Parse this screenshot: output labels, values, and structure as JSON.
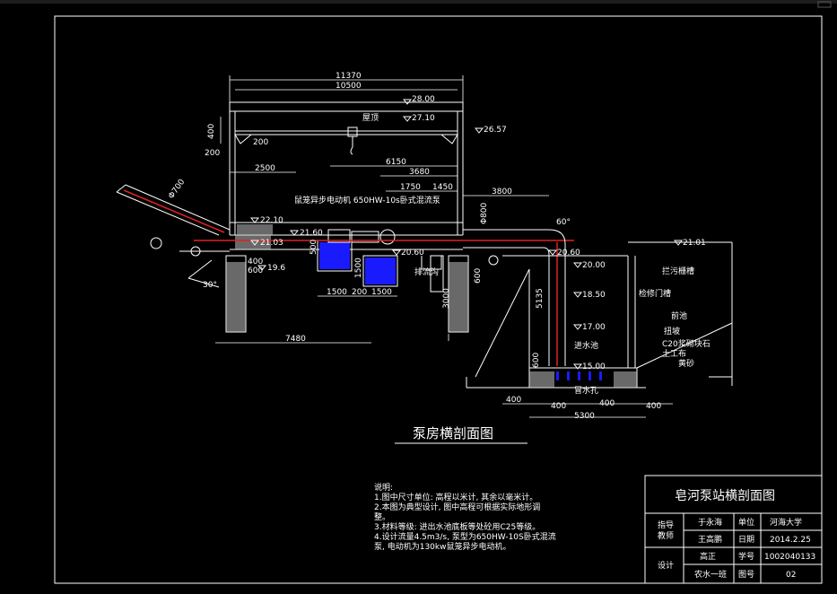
{
  "drawing": {
    "title": "泵房横剖面图",
    "dimensions": {
      "d11370": "11370",
      "d10500": "10500",
      "d400": "400",
      "d200a": "200",
      "d200b": "200",
      "d2500": "2500",
      "d6150": "6150",
      "d3680": "3680",
      "d1750": "1750",
      "d1450": "1450",
      "d3800": "3800",
      "phi800": "Φ800",
      "phi700": "Φ700",
      "d400b": "400",
      "d600": "600",
      "d500": "500",
      "d1500a": "1500",
      "d200c": "200",
      "d1500b": "1500",
      "d1500v": "1500",
      "d3000": "3000",
      "d600b": "600",
      "d5135": "5135",
      "d7480": "7480",
      "d400c": "400",
      "d400d": "400",
      "d400e": "400",
      "d400f": "400",
      "d5300": "5300",
      "ang30": "30°",
      "ang60": "60°",
      "d600c": "600"
    },
    "elevations": {
      "e2800": "28.00",
      "e2710": "27.10",
      "e2657": "26.57",
      "e2210": "22.10",
      "e2160": "21.60",
      "e2103": "21.03",
      "e196": "19.6",
      "e2060": "20.60",
      "e2060b": "20.60",
      "e2000": "20.00",
      "e2101": "21.01",
      "e1850": "18.50",
      "e1700": "17.00",
      "e1500": "15.00"
    },
    "labels": {
      "roof": "屋顶",
      "motor_pump": "鼠笼异步电动机  650HW-10s卧式混流泵",
      "drain_ditch": "排流沟",
      "trash_rack": "拦污栅槽",
      "gate_slot": "检修门槽",
      "forebay": "前池",
      "slope": "扭坡",
      "concrete": "C20浆砌块石",
      "geotextile": "土工布",
      "sand": "黄砂",
      "inlet_pool": "进水池",
      "drain_hole": "冒水孔"
    }
  },
  "notes": {
    "heading": "说明:",
    "lines": [
      "1.图中尺寸单位: 高程以米计, 其余以毫米计。",
      "2.本图为典型设计, 图中高程可根据实际地形调",
      "整。",
      "3.材料等级: 进出水池底板等处砼用C25等级。",
      "4.设计流量4.5m3/s, 泵型为650HW-10S卧式混流",
      "泵, 电动机为130kw鼠笼异步电动机。"
    ]
  },
  "title_block": {
    "title": "皂河泵站横剖面图",
    "advisor_label": "指导\n教师",
    "advisor_name": "于永海",
    "advisor2": "王高鹏",
    "unit_label": "单位",
    "unit_value": "河海大学",
    "date_label": "日期",
    "date_value": "2014.2.25",
    "design_label": "设计",
    "designer": "高正",
    "class_name": "农水一班",
    "student_no_label": "学号",
    "student_no": "1002040133",
    "drawing_no_label": "图号",
    "drawing_no": "02"
  },
  "colors": {
    "background": "#000000",
    "line": "#ffffff",
    "pipe_red": "#e02020",
    "pump_blue": "#1a1aff",
    "hatch": "#bfbfbf"
  }
}
